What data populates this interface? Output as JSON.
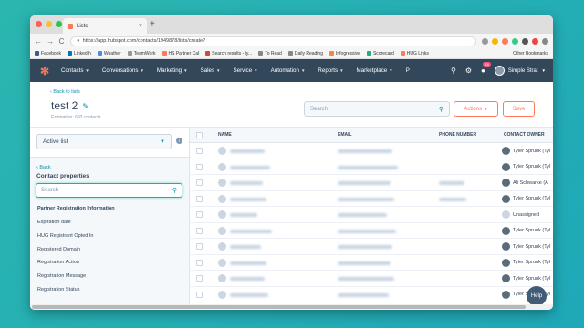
{
  "browser": {
    "tab_title": "Lists",
    "tab_close": "×",
    "new_tab": "+",
    "url": "https://app.hubspot.com/contacts/1949878/lists/create?",
    "back": "←",
    "forward": "→",
    "reload": "C",
    "bookmarks": [
      {
        "label": "Facebook",
        "color": "#3b5998"
      },
      {
        "label": "LinkedIn",
        "color": "#0077b5"
      },
      {
        "label": "Weather",
        "color": "#4a90d9"
      },
      {
        "label": "TeamWork",
        "color": "#999"
      },
      {
        "label": "HS Partner Cal",
        "color": "#ff7a59"
      },
      {
        "label": "Search results - ty...",
        "color": "#d44638"
      },
      {
        "label": "To Read",
        "color": "#888"
      },
      {
        "label": "Daily Reading",
        "color": "#888"
      },
      {
        "label": "Infogressive",
        "color": "#e84"
      },
      {
        "label": "Scorecard",
        "color": "#2a8"
      },
      {
        "label": "HUG Links",
        "color": "#ff7a59"
      }
    ],
    "other_bookmarks": "Other Bookmarks"
  },
  "hubspot_nav": {
    "items": [
      "Contacts",
      "Conversations",
      "Marketing",
      "Sales",
      "Service",
      "Automation",
      "Reports",
      "Marketplace",
      "P"
    ],
    "notifications": "16",
    "account": "Simple Strat",
    "accent": "#ff7a59"
  },
  "header": {
    "back_link": "‹ Back to lists",
    "title": "test 2",
    "estimation": "Estimation: 693 contacts",
    "search_placeholder": "Search",
    "actions_label": "Actions",
    "save_label": "Save"
  },
  "sidebar": {
    "list_type": "Active list",
    "info": "i",
    "back": "‹ Back",
    "panel_title": "Contact properties",
    "search_placeholder": "Search",
    "group_heading": "Partner Registration Information",
    "properties": [
      "Expiration date",
      "HUG Registrant Opted In",
      "Registered Domain",
      "Registration Action",
      "Registration Message",
      "Registration Status"
    ]
  },
  "table": {
    "columns": [
      "NAME",
      "EMAIL",
      "PHONE NUMBER",
      "CONTACT OWNER"
    ],
    "owners": [
      "Tyler Sprunk (Tyl",
      "Tyler Sprunk (Tyl",
      "Ali Schwarke (A",
      "Tyler Sprunk (Tyl",
      "Unassigned",
      "Tyler Sprunk (Tyl",
      "Tyler Sprunk (Tyl",
      "Tyler Sprunk (Tyl",
      "Tyler Sprunk (Tyl",
      "Tyler Sprunk (Tyl"
    ]
  },
  "help_label": "Help"
}
